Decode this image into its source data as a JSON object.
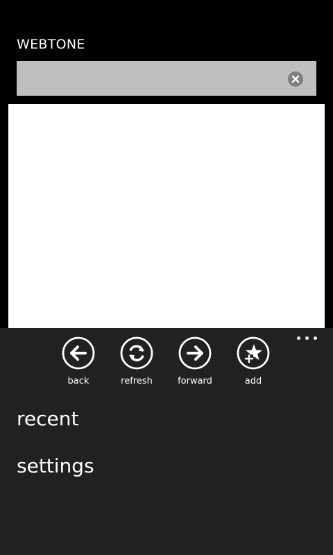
{
  "app": {
    "title": "WEBTONE"
  },
  "address_bar": {
    "value": "",
    "placeholder": ""
  },
  "app_bar": {
    "buttons": [
      {
        "label": "back",
        "icon": "arrow-left-icon"
      },
      {
        "label": "refresh",
        "icon": "refresh-icon"
      },
      {
        "label": "forward",
        "icon": "arrow-right-icon"
      },
      {
        "label": "add",
        "icon": "star-add-icon"
      }
    ],
    "menu_items": [
      {
        "label": "recent"
      },
      {
        "label": "settings"
      }
    ]
  },
  "colors": {
    "background": "#000000",
    "address_bar": "#bfbfbf",
    "clear_button": "#7f7f7f",
    "app_bar": "#212121",
    "web_view": "#ffffff",
    "foreground": "#ffffff"
  }
}
